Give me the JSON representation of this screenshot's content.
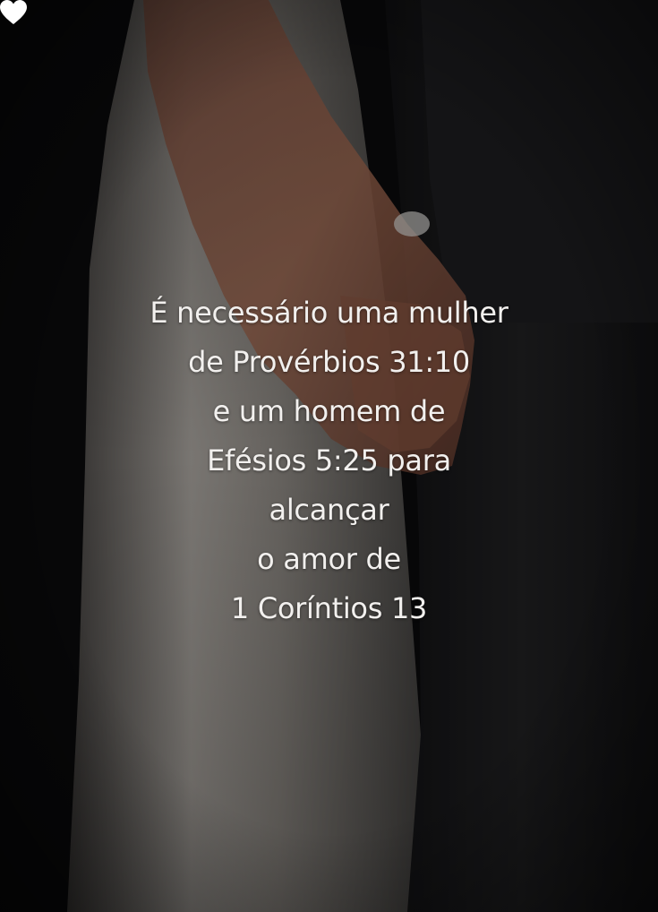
{
  "quote": {
    "lines": [
      "É necessário uma mulher",
      "de Provérbios 31:10",
      "e um homem de",
      "Efésios 5:25 para",
      "alcançar",
      "o amor de",
      "1 Coríntios 13"
    ]
  },
  "heart": {
    "icon": "heart-icon",
    "color": "#ffffff"
  },
  "colors": {
    "background": "#0c0c0c",
    "dress": "#8f8b86",
    "suit": "#1b1b1d",
    "text": "#f2f0ee"
  }
}
